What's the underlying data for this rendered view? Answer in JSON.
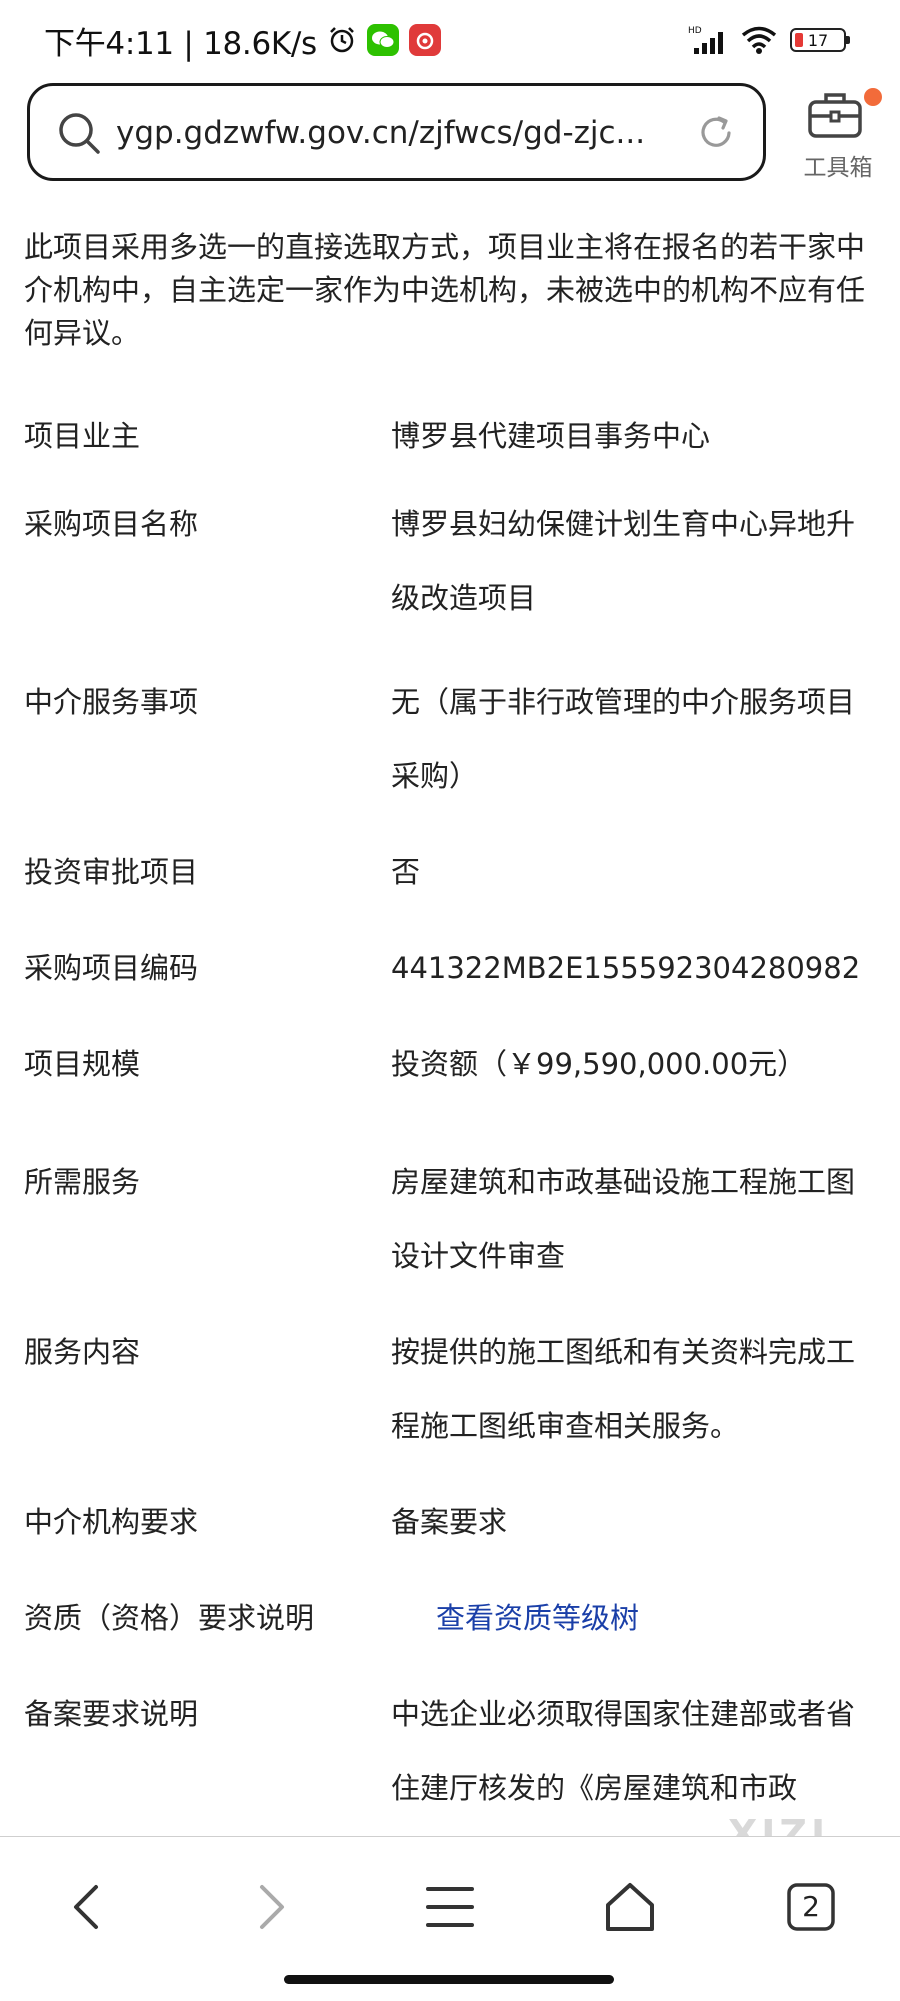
{
  "status_bar": {
    "time_speed": "下午4:11 | 18.6K/s",
    "network": "HD",
    "battery": "17"
  },
  "address_bar": {
    "url": "ygp.gdzwfw.gov.cn/zjfwcs/gd-zjc..."
  },
  "toolbox": {
    "label": "工具箱"
  },
  "intro_text": "此项目采用多选一的直接选取方式，项目业主将在报名的若干家中介机构中，自主选定一家作为中选机构，未被选中的机构不应有任何异议。",
  "rows": [
    {
      "label": "项目业主",
      "value": "博罗县代建项目事务中心"
    },
    {
      "label": "采购项目名称",
      "value": "博罗县妇幼保健计划生育中心异地升级改造项目"
    },
    {
      "label": "中介服务事项",
      "value": "无（属于非行政管理的中介服务项目采购）"
    },
    {
      "label": "投资审批项目",
      "value": "否"
    },
    {
      "label": "采购项目编码",
      "value": "441322MB2E155592304280982"
    },
    {
      "label": "项目规模",
      "value": "投资额（￥99,590,000.00元）"
    },
    {
      "label": "所需服务",
      "value": "房屋建筑和市政基础设施工程施工图设计文件审查"
    },
    {
      "label": "服务内容",
      "value": "按提供的施工图纸和有关资料完成工程施工图纸审查相关服务。"
    },
    {
      "label": "中介机构要求",
      "value": "备案要求"
    },
    {
      "label": "资质（资格）要求说明",
      "value": "查看资质等级树"
    },
    {
      "label": "备案要求说明",
      "value": "中选企业必须取得国家住建部或者省住建厅核发的《房屋建筑和市政"
    }
  ],
  "bottom_nav": {
    "tab_count": "2"
  },
  "watermark": "XIZI",
  "colors": {
    "link": "#1a3fa8",
    "badge": "#f26b3a"
  }
}
